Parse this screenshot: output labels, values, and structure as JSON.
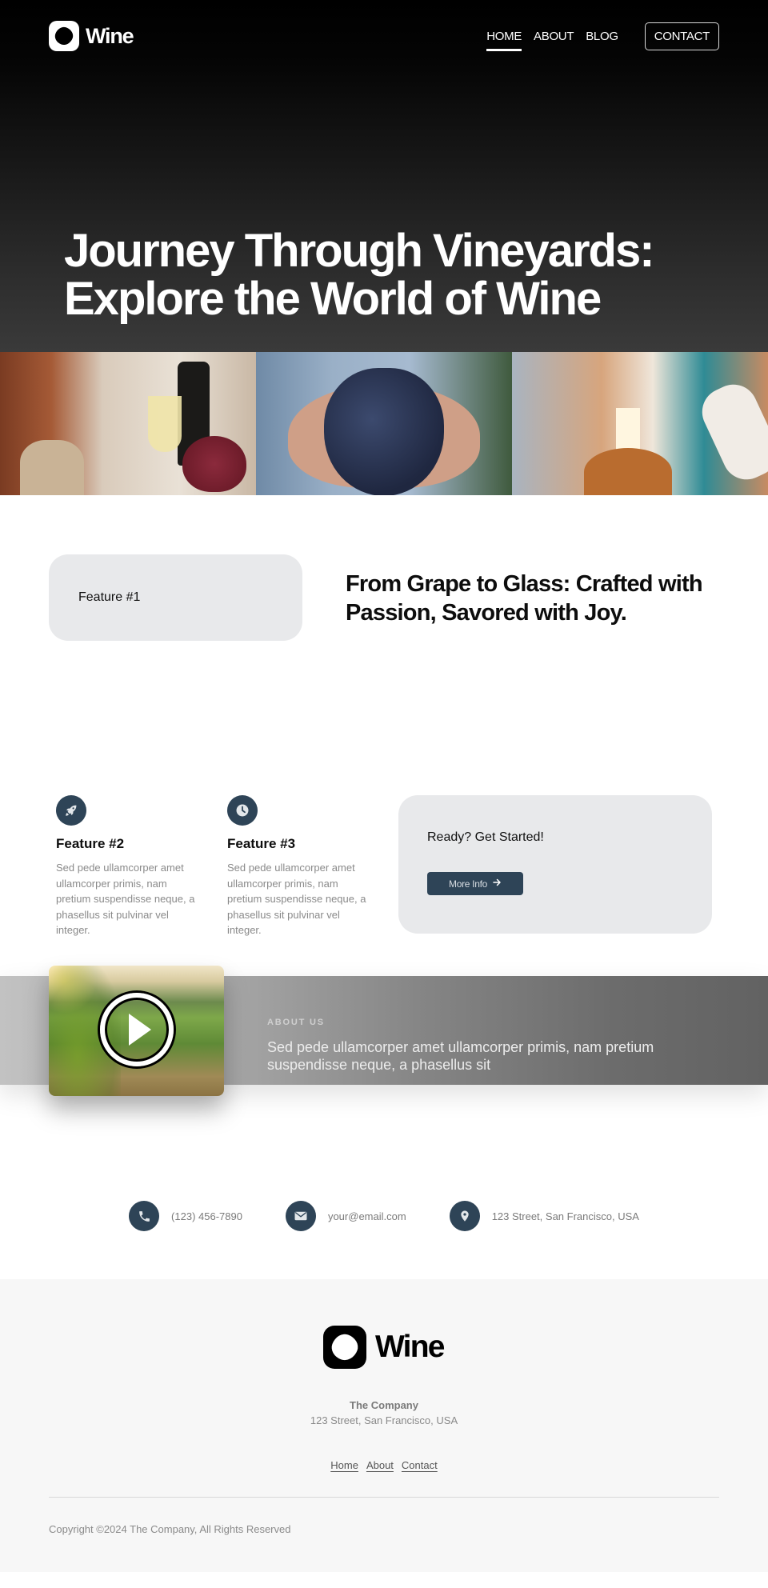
{
  "brand": {
    "name": "Wine",
    "logo_icon": "wine-logo-icon"
  },
  "nav": {
    "items": [
      {
        "label": "HOME",
        "active": true
      },
      {
        "label": "ABOUT",
        "active": false
      },
      {
        "label": "BLOG",
        "active": false
      }
    ],
    "cta_label": "CONTACT"
  },
  "hero": {
    "title_line1": "Journey Through Vineyards:",
    "title_line2": "Explore the World of Wine"
  },
  "gallery": {
    "images": [
      {
        "alt": "White wine glass, bottle and grapes on table"
      },
      {
        "alt": "Hands holding a bunch of dark grapes"
      },
      {
        "alt": "People toasting with wine at a dinner table"
      }
    ]
  },
  "feature1": {
    "card_label": "Feature #1",
    "heading": "From Grape to Glass: Crafted with Passion, Savored with Joy."
  },
  "features": [
    {
      "icon": "rocket-icon",
      "title": "Feature #2",
      "description": "Sed pede ullamcorper amet ullamcorper primis, nam pretium suspendisse neque, a phasellus sit pulvinar vel integer."
    },
    {
      "icon": "clock-icon",
      "title": "Feature #3",
      "description": "Sed pede ullamcorper amet ullamcorper primis, nam pretium suspendisse neque, a phasellus sit pulvinar vel integer."
    }
  ],
  "cta": {
    "title": "Ready? Get Started!",
    "button_label": "More Info",
    "button_icon": "arrow-right-icon"
  },
  "about": {
    "eyebrow": "ABOUT US",
    "text": "Sed pede ullamcorper amet ullamcorper primis, nam pretium suspendisse neque, a phasellus sit",
    "video_icon": "play-icon"
  },
  "contact": [
    {
      "icon": "phone-icon",
      "text": "(123) 456-7890"
    },
    {
      "icon": "envelope-icon",
      "text": "your@email.com"
    },
    {
      "icon": "map-pin-icon",
      "text": "123 Street, San Francisco, USA"
    }
  ],
  "footer": {
    "company": "The Company",
    "address": "123 Street, San Francisco, USA",
    "links": [
      "Home",
      "About",
      "Contact"
    ],
    "copyright": "Copyright ©2024 The Company, All Rights Reserved"
  },
  "colors": {
    "accent": "#2e4457",
    "card_bg": "#e8e9eb",
    "footer_bg": "#f7f7f7",
    "muted_text": "#8a8a8a"
  }
}
